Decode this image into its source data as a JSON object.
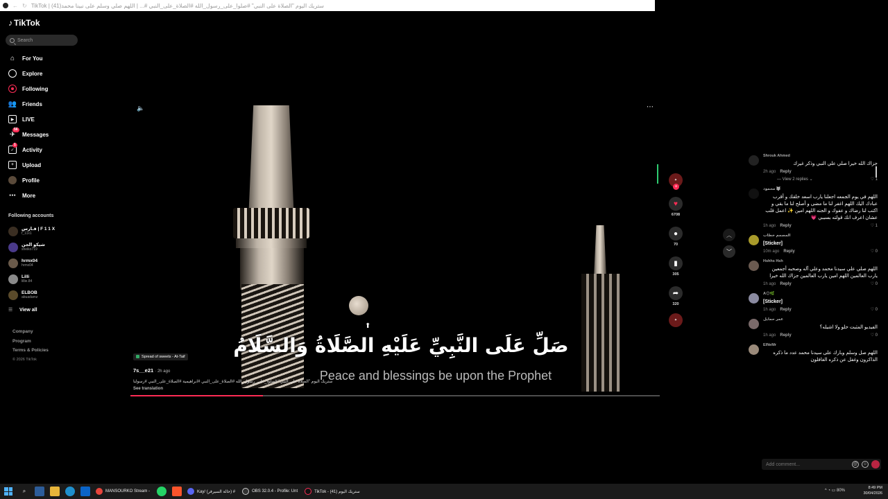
{
  "browser": {
    "title": "TikTok | ستريك اليوم \"الصلاة على النبي\" #صلوا_على_رسول_الله #الصلاة_على_النبي #... | اللهم صلي وسلم على نبينا محمد(41)"
  },
  "sidebar": {
    "logo": "TikTok",
    "search_placeholder": "Search",
    "nav": [
      {
        "label": "For You",
        "icon": "home-icon"
      },
      {
        "label": "Explore",
        "icon": "compass-icon"
      },
      {
        "label": "Following",
        "icon": "following-icon"
      },
      {
        "label": "Friends",
        "icon": "friends-icon"
      },
      {
        "label": "LIVE",
        "icon": "live-icon"
      },
      {
        "label": "Messages",
        "icon": "messages-icon",
        "badge": "56"
      },
      {
        "label": "Activity",
        "icon": "activity-icon",
        "badge": "1"
      },
      {
        "label": "Upload",
        "icon": "upload-icon"
      },
      {
        "label": "Profile",
        "icon": "profile-avatar-icon"
      },
      {
        "label": "More",
        "icon": "more-dots-icon"
      }
    ],
    "following_title": "Following accounts",
    "accounts": [
      {
        "name": "فـارس | F 1 1 X",
        "handle": "f_11x1"
      },
      {
        "name": "شيكو الجن",
        "handle": "sheiko719"
      },
      {
        "name": "hrmx04",
        "handle": "hrmx04"
      },
      {
        "name": "Lilli",
        "handle": "lillie.84"
      },
      {
        "name": "ELBOB",
        "handle": "abuadamz"
      }
    ],
    "view_all": "View all",
    "footer": [
      "Company",
      "Program",
      "Terms & Policies"
    ],
    "copyright": "© 2026 TikTok"
  },
  "video": {
    "caption_arabic": "صَلِّ عَلَى النَّبِيِّ عَلَيْهِ الصَّلَاةُ وَالسَّلَامُ",
    "caption_english": "Peace and blessings be upon the Prophet",
    "sound": "Spread of sweets - At-Taif",
    "author": "7s__e21",
    "time": "· 2h ago",
    "description": "ستريك اليوم \"الصلاة على النبي\" #صلوا_على_رسول_الله #الصلاة_على_النبي #ابراهيمية #الصلاة_على_النبي #رسولنا",
    "see_translation": "See translation",
    "progress": 0.25
  },
  "actions": {
    "likes": "6708",
    "comments": "70",
    "saves": "305",
    "shares": "320"
  },
  "comments": [
    {
      "user": "Shrouk Ahmed",
      "text": "جزاك الله خيرا صلي علي النبي وذكر غيرك",
      "time": "2h ago",
      "reply": "Reply",
      "likes": "1",
      "view_replies": "View 2 replies"
    },
    {
      "user": "محمود 🐺",
      "text": "اللهم في يوم الجمعه اجعلنا يارب اسعد خلقك و أقرب عبادك اليك اللهم اغفر لنا ما مضى و أصلح لنا ما بقي و اكتب لنا رضاك و عفوك و الجنه اللهم امين ✨ اعمل قلب عشان اعرف انك قولته بسببي 💗",
      "time": "1h ago",
      "reply": "Reply",
      "likes": "1"
    },
    {
      "user": "المصمم خطاب",
      "text": "[Sticker]",
      "time": "10m ago",
      "reply": "Reply",
      "likes": "0",
      "ltr": true
    },
    {
      "user": "Hshhs Hsh",
      "text": "اللهم صلي علي سيدنا محمد وعلي آله وصحبه أجمعين يارب العالمين اللهم امين يارب العالمين جزاك الله خيرا",
      "time": "1h ago",
      "reply": "Reply",
      "likes": "0"
    },
    {
      "user": "A😊🌿",
      "text": "[Sticker]",
      "time": "1h ago",
      "reply": "Reply",
      "likes": "0",
      "ltr": true
    },
    {
      "user": "عمر حمايل",
      "text": "الفيديو المثبت حلو ولا اشيله؟",
      "time": "1h ago",
      "reply": "Reply",
      "likes": "0"
    },
    {
      "user": "ElNeMr",
      "text": "اللهم صل وسلم وبارك على سيدنا محمد عدد ما ذكره الذاكرون وغفل عن ذكره الغافلون",
      "time": "",
      "reply": "",
      "likes": ""
    }
  ],
  "add_comment_placeholder": "Add comment...",
  "taskbar": {
    "tasks": [
      "MANSOURKO Stream -",
      "Kay/ (حالة السيرفر) #",
      "OBS 32.0.4 - Profile: Unt",
      "TikTok - ستريك اليوم (41)"
    ],
    "battery": "80%",
    "time": "8:49 PM",
    "date": "30/04/2026"
  },
  "colors": {
    "accent": "#fe2c55",
    "background": "#000000",
    "live_green": "#2ecc71"
  }
}
